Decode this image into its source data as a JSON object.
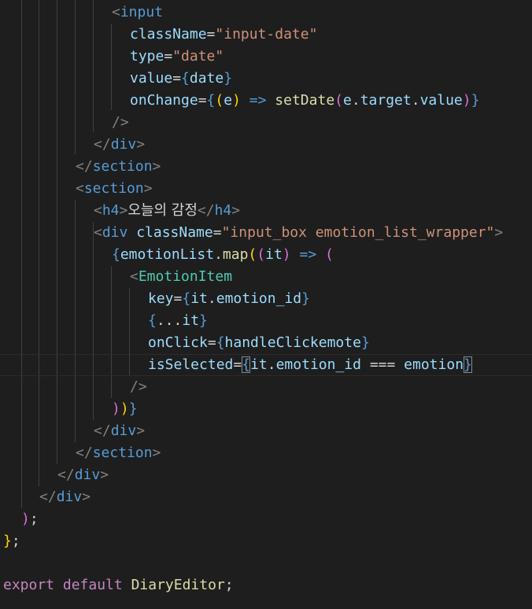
{
  "editor": {
    "language": "javascript-jsx",
    "theme": "dark",
    "tokens": {
      "lt": "<",
      "lt_slash": "</",
      "gt": ">",
      "self_close": "/>",
      "eq": "=",
      "arrow": "=>",
      "triple_eq": "===",
      "dot": ".",
      "semi": ";",
      "lbrace": "{",
      "rbrace": "}",
      "lparen": "(",
      "rparen": ")",
      "spread": "..."
    },
    "words": {
      "input": "input",
      "className": "className",
      "type": "type",
      "value": "value",
      "onChange": "onChange",
      "input_date": "\"input-date\"",
      "date_str": "\"date\"",
      "date": "date",
      "e": "e",
      "setDate": "setDate",
      "target": "target",
      "div": "div",
      "section": "section",
      "h4": "h4",
      "heading_text": "오늘의 감정",
      "wrapper_class": "\"input_box emotion_list_wrapper\"",
      "emotionList": "emotionList",
      "map": "map",
      "it": "it",
      "EmotionItem": "EmotionItem",
      "key": "key",
      "emotion_id": "emotion_id",
      "onClick": "onClick",
      "handleClickemote": "handleClickemote",
      "isSelected": "isSelected",
      "emotion": "emotion",
      "export": "export",
      "default": "default",
      "DiaryEditor": "DiaryEditor"
    },
    "colors": {
      "background": "#1e1e1e",
      "tag": "#569cd6",
      "component": "#4ec9b0",
      "attribute": "#9cdcfe",
      "string": "#ce9178",
      "function": "#dcdcaa",
      "keyword": "#c586c0",
      "bracket_gold": "#ffd700",
      "bracket_orchid": "#da70d6",
      "bracket_blue": "#179fff"
    }
  }
}
